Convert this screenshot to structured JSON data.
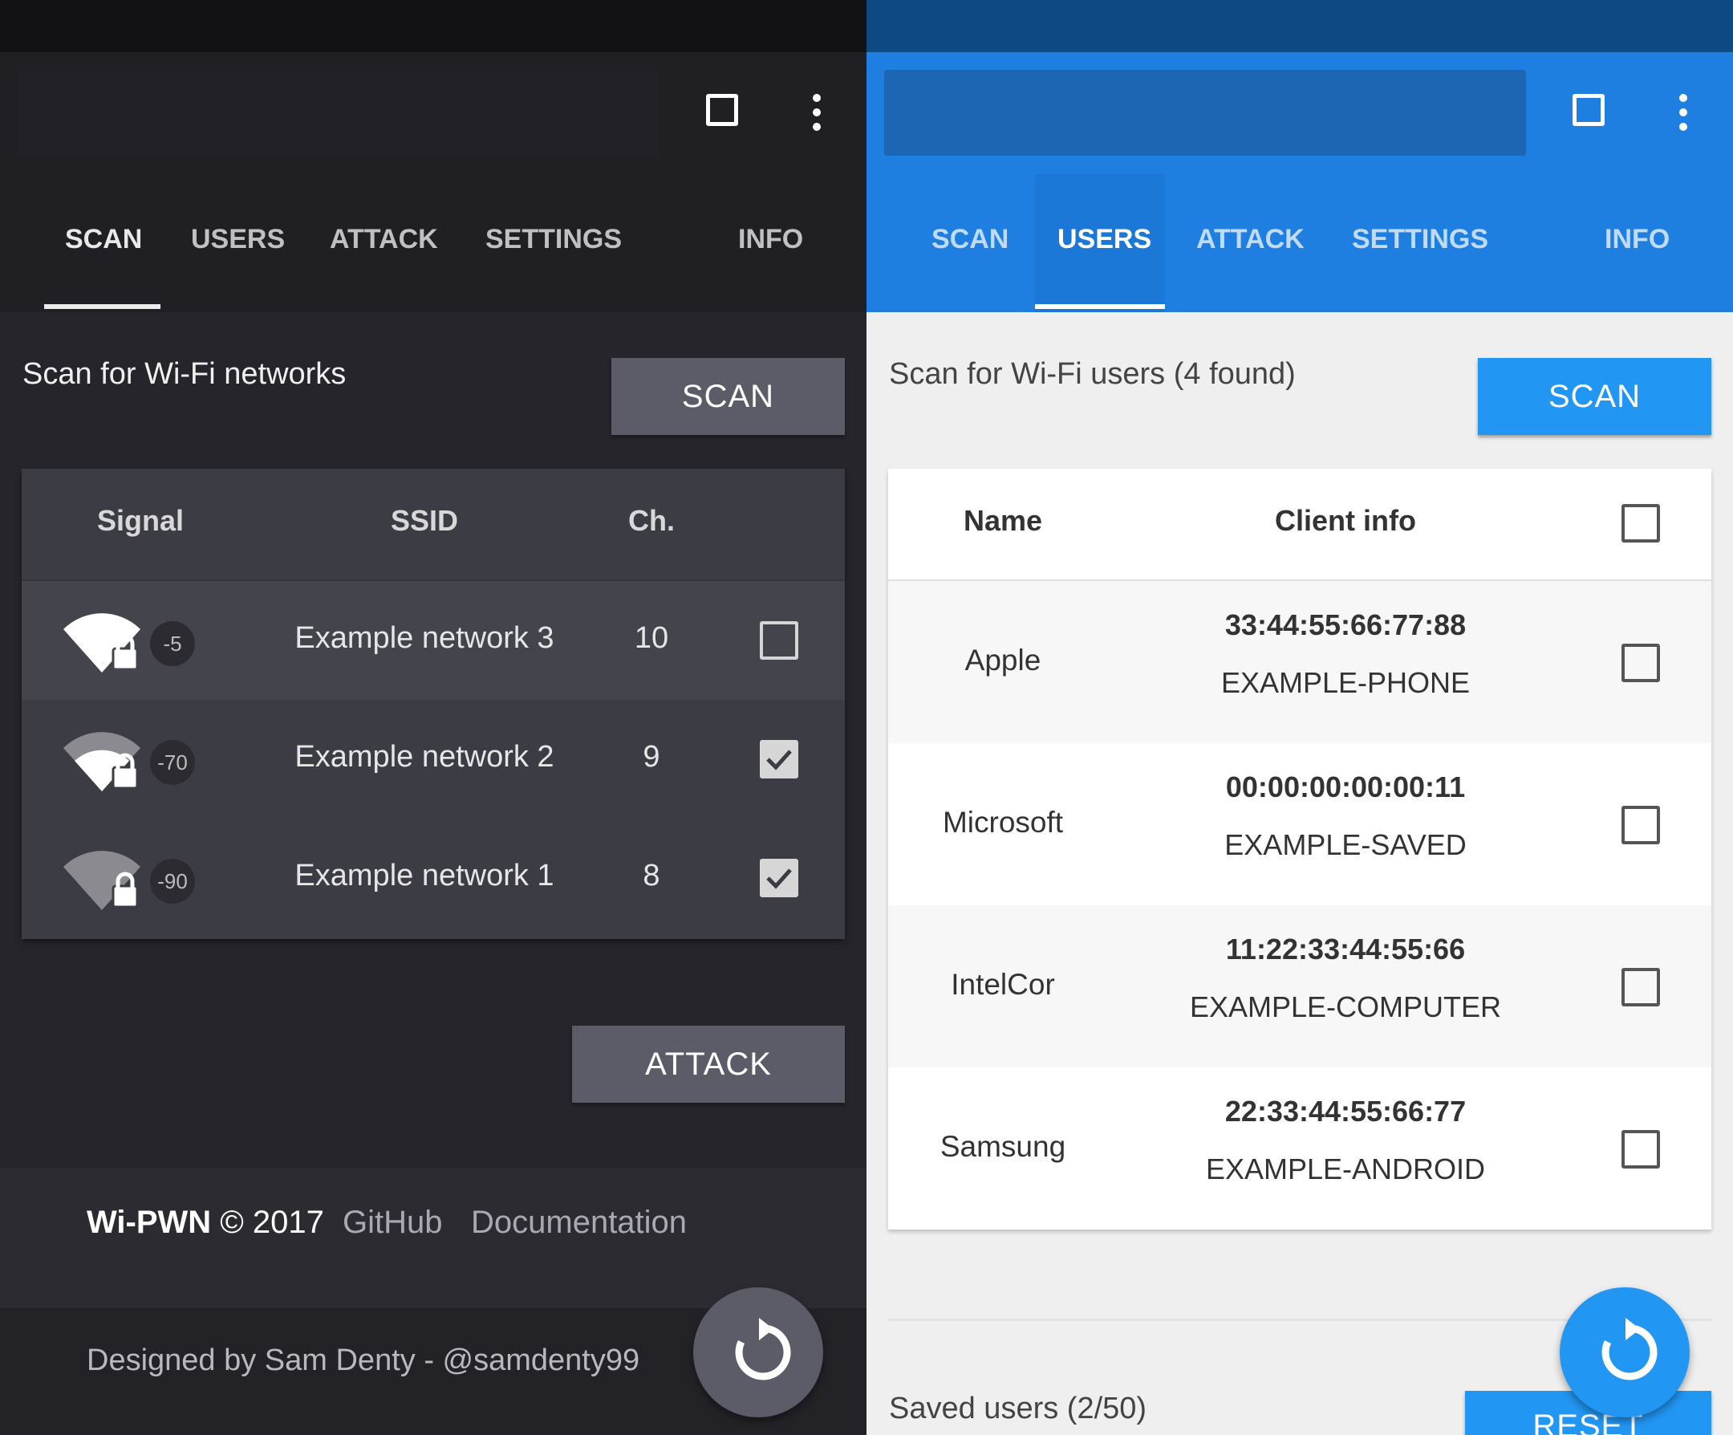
{
  "left": {
    "nav": {
      "tabs": [
        "SCAN",
        "USERS",
        "ATTACK",
        "SETTINGS",
        "INFO"
      ],
      "active": "SCAN"
    },
    "title": "Scan for Wi-Fi networks",
    "scan_button": "SCAN",
    "table": {
      "headers": {
        "signal": "Signal",
        "ssid": "SSID",
        "channel": "Ch."
      },
      "rows": [
        {
          "rssi": "-5",
          "ssid": "Example network 3",
          "channel": "10",
          "checked": false
        },
        {
          "rssi": "-70",
          "ssid": "Example network 2",
          "channel": "9",
          "checked": true
        },
        {
          "rssi": "-90",
          "ssid": "Example network 1",
          "channel": "8",
          "checked": true
        }
      ]
    },
    "attack_button": "ATTACK",
    "footer": {
      "brand": "Wi-PWN",
      "copyright": "© 2017",
      "links": [
        "GitHub",
        "Documentation"
      ],
      "credit": "Designed by Sam Denty - @samdenty99"
    },
    "colors": {
      "bg": "#25252b",
      "button": "#5c5c68"
    }
  },
  "right": {
    "nav": {
      "tabs": [
        "SCAN",
        "USERS",
        "ATTACK",
        "SETTINGS",
        "INFO"
      ],
      "active": "USERS"
    },
    "title": "Scan for Wi-Fi users (4 found)",
    "scan_button": "SCAN",
    "table": {
      "headers": {
        "name": "Name",
        "client_info": "Client info"
      },
      "rows": [
        {
          "vendor": "Apple",
          "mac": "33:44:55:66:77:88",
          "host": "EXAMPLE-PHONE"
        },
        {
          "vendor": "Microsoft",
          "mac": "00:00:00:00:00:11",
          "host": "EXAMPLE-SAVED"
        },
        {
          "vendor": "IntelCor",
          "mac": "11:22:33:44:55:66",
          "host": "EXAMPLE-COMPUTER"
        },
        {
          "vendor": "Samsung",
          "mac": "22:33:44:55:66:77",
          "host": "EXAMPLE-ANDROID"
        }
      ]
    },
    "saved_users": "Saved users (2/50)",
    "reset_button": "RESET",
    "colors": {
      "primary": "#1f7fe0",
      "button": "#2196f3"
    }
  }
}
